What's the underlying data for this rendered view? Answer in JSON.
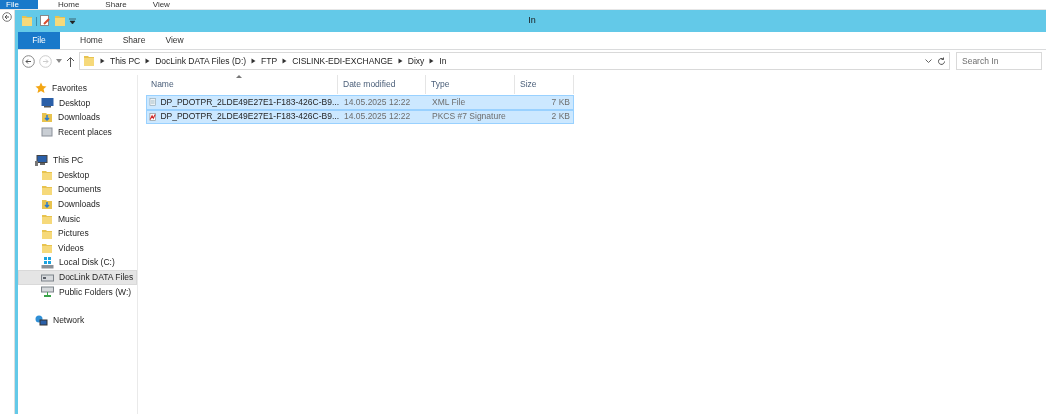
{
  "background_window": {
    "ribbon_tabs": [
      {
        "label": "File",
        "selected": true
      },
      {
        "label": "Home",
        "selected": false
      },
      {
        "label": "Share",
        "selected": false
      },
      {
        "label": "View",
        "selected": false
      }
    ]
  },
  "window": {
    "title": "In",
    "ribbon_tabs": [
      {
        "label": "File",
        "selected": true
      },
      {
        "label": "Home",
        "selected": false
      },
      {
        "label": "Share",
        "selected": false
      },
      {
        "label": "View",
        "selected": false
      }
    ],
    "address": {
      "path": [
        "This PC",
        "DocLink DATA Files (D:)",
        "FTP",
        "CISLINK-EDI-EXCHANGE",
        "Dixy",
        "In"
      ]
    },
    "search": {
      "placeholder": "Search In"
    },
    "navigation": [
      {
        "label": "Favorites",
        "kind": "star",
        "selected": false,
        "children": [
          {
            "label": "Desktop",
            "kind": "desktop",
            "selected": false
          },
          {
            "label": "Downloads",
            "kind": "download",
            "selected": false
          },
          {
            "label": "Recent places",
            "kind": "recent",
            "selected": false
          }
        ]
      },
      {
        "label": "This PC",
        "kind": "pc",
        "selected": false,
        "children": [
          {
            "label": "Desktop",
            "kind": "folder",
            "selected": false
          },
          {
            "label": "Documents",
            "kind": "folder",
            "selected": false
          },
          {
            "label": "Downloads",
            "kind": "download",
            "selected": false
          },
          {
            "label": "Music",
            "kind": "folder",
            "selected": false
          },
          {
            "label": "Pictures",
            "kind": "folder",
            "selected": false
          },
          {
            "label": "Videos",
            "kind": "folder",
            "selected": false
          },
          {
            "label": "Local Disk (C:)",
            "kind": "disk",
            "selected": false
          },
          {
            "label": "DocLink DATA Files",
            "kind": "drive",
            "selected": true
          },
          {
            "label": "Public Folders (W:)",
            "kind": "netdrive",
            "selected": false
          }
        ]
      },
      {
        "label": "Network",
        "kind": "network",
        "selected": false
      }
    ],
    "columns": [
      "Name",
      "Date modified",
      "Type",
      "Size"
    ],
    "rows": [
      {
        "name": "DP_PDOTPR_2LDE49E27E1-F183-426C-B9...",
        "date": "14.05.2025 12:22",
        "type": "XML File",
        "size": "7 KB",
        "kind": "xml",
        "selected": true
      },
      {
        "name": "DP_PDOTPR_2LDE49E27E1-F183-426C-B9...",
        "date": "14.05.2025 12:22",
        "type": "PKCS #7 Signature",
        "size": "2 KB",
        "kind": "signature",
        "selected": true
      }
    ]
  }
}
